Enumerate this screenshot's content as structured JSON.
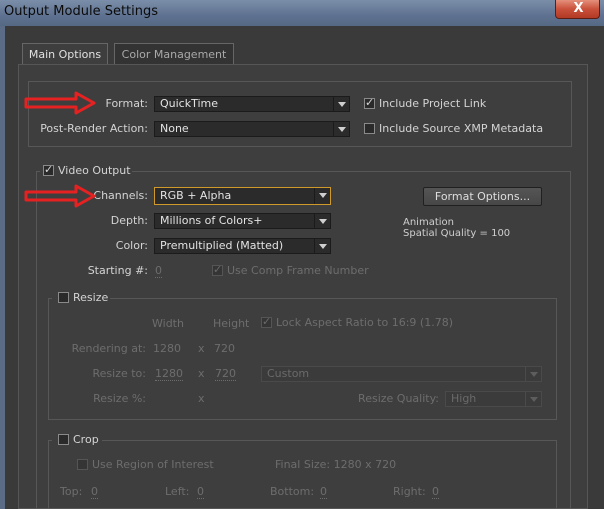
{
  "window": {
    "title": "Output Module Settings",
    "close_glyph": "X"
  },
  "tabs": [
    {
      "label": "Main Options",
      "active": true
    },
    {
      "label": "Color Management",
      "active": false
    }
  ],
  "format_section": {
    "format_label": "Format:",
    "format_value": "QuickTime",
    "post_render_label": "Post-Render Action:",
    "post_render_value": "None",
    "include_project_link": {
      "label": "Include Project Link",
      "checked": true
    },
    "include_xmp": {
      "label": "Include Source XMP Metadata",
      "checked": false
    }
  },
  "video_output": {
    "label": "Video Output",
    "checked": true,
    "channels_label": "Channels:",
    "channels_value": "RGB + Alpha",
    "depth_label": "Depth:",
    "depth_value": "Millions of Colors+",
    "color_label": "Color:",
    "color_value": "Premultiplied (Matted)",
    "starting_label": "Starting #:",
    "starting_value": "0",
    "use_comp_frame": {
      "label": "Use Comp Frame Number",
      "checked": true
    },
    "format_options_button": "Format Options...",
    "codec_info_line1": "Animation",
    "codec_info_line2": "Spatial Quality = 100"
  },
  "resize": {
    "label": "Resize",
    "checked": false,
    "width_header": "Width",
    "height_header": "Height",
    "lock_aspect": {
      "label": "Lock Aspect Ratio to 16:9 (1.78)",
      "checked": true
    },
    "rendering_at_label": "Rendering at:",
    "rendering_width": "1280",
    "rendering_x": "x",
    "rendering_height": "720",
    "resize_to_label": "Resize to:",
    "resize_to_width": "1280",
    "resize_to_x": "x",
    "resize_to_height": "720",
    "preset_value": "Custom",
    "resize_pct_label": "Resize %:",
    "resize_pct_x": "x",
    "quality_label": "Resize Quality:",
    "quality_value": "High"
  },
  "crop": {
    "label": "Crop",
    "checked": false,
    "use_roi": {
      "label": "Use Region of Interest",
      "checked": false
    },
    "final_size": "Final Size: 1280 x 720",
    "top_label": "Top:",
    "top_value": "0",
    "left_label": "Left:",
    "left_value": "0",
    "bottom_label": "Bottom:",
    "bottom_value": "0",
    "right_label": "Right:",
    "right_value": "0"
  },
  "colors": {
    "arrow": "#e52121",
    "highlight": "#d09a2a",
    "background": "#3a3a3a"
  }
}
